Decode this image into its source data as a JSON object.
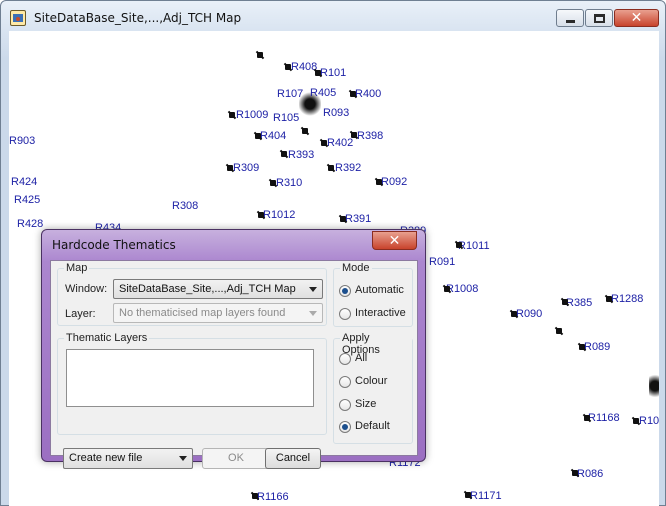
{
  "window": {
    "title": "SiteDataBase_Site,...,Adj_TCH Map"
  },
  "map": {
    "labels": [
      {
        "text": "R408"
      },
      {
        "text": "R101"
      },
      {
        "text": "R107"
      },
      {
        "text": "R405"
      },
      {
        "text": "R400"
      },
      {
        "text": "R1009"
      },
      {
        "text": "R105"
      },
      {
        "text": "R093"
      },
      {
        "text": "R404"
      },
      {
        "text": "R402"
      },
      {
        "text": "R398"
      },
      {
        "text": "R903"
      },
      {
        "text": "R393"
      },
      {
        "text": "R309"
      },
      {
        "text": "R392"
      },
      {
        "text": "R424"
      },
      {
        "text": "R310"
      },
      {
        "text": "R092"
      },
      {
        "text": "R425"
      },
      {
        "text": "R308"
      },
      {
        "text": "R1012"
      },
      {
        "text": "R391"
      },
      {
        "text": "R428"
      },
      {
        "text": "R434"
      },
      {
        "text": "R389"
      },
      {
        "text": "R1011"
      },
      {
        "text": "R091"
      },
      {
        "text": "R1008"
      },
      {
        "text": "R385"
      },
      {
        "text": "R1288"
      },
      {
        "text": "R090"
      },
      {
        "text": "R089"
      },
      {
        "text": "R1168"
      },
      {
        "text": "R10"
      },
      {
        "text": "R1172"
      },
      {
        "text": "R086"
      },
      {
        "text": "R1166"
      },
      {
        "text": "R1171"
      }
    ]
  },
  "dialog": {
    "title": "Hardcode Thematics",
    "map_group": {
      "title": "Map",
      "window_label": "Window:",
      "window_value": "SiteDataBase_Site,...,Adj_TCH Map",
      "layer_label": "Layer:",
      "layer_value": "No thematicised map layers found"
    },
    "thematic_layers": {
      "title": "Thematic Layers"
    },
    "mode": {
      "title": "Mode",
      "options": [
        {
          "label": "Automatic",
          "checked": true
        },
        {
          "label": "Interactive",
          "checked": false
        }
      ]
    },
    "apply_options": {
      "title": "Apply Options",
      "options": [
        {
          "label": "All",
          "checked": false
        },
        {
          "label": "Colour",
          "checked": false
        },
        {
          "label": "Size",
          "checked": false
        },
        {
          "label": "Default",
          "checked": true
        }
      ]
    },
    "file_select": "Create new file",
    "ok_label": "OK",
    "cancel_label": "Cancel"
  }
}
